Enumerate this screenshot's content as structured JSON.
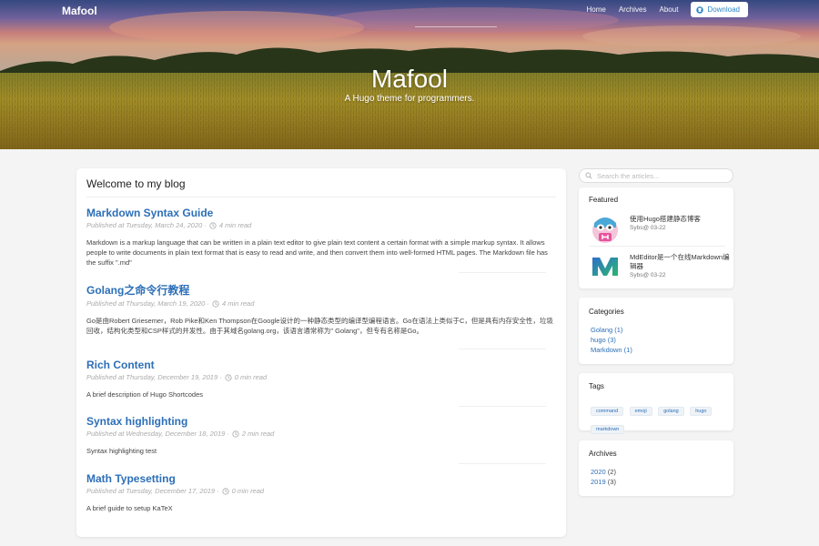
{
  "nav": {
    "brand": "Mafool",
    "links": [
      "Home",
      "Archives",
      "About"
    ],
    "download_label": "Download"
  },
  "hero": {
    "title": "Mafool",
    "subtitle": "A Hugo theme for programmers."
  },
  "main": {
    "heading": "Welcome to my blog",
    "posts": [
      {
        "title": "Markdown Syntax Guide",
        "published": "Published at Tuesday, March 24, 2020 ·",
        "read_time": "4 min read",
        "summary": "Markdown is a markup language that can be written in a plain text editor to give plain text content a certain format with a simple markup syntax. It allows people to write documents in plain text format that is easy to read and write, and then convert them into well-formed HTML pages. The Markdown file has the suffix \".md\""
      },
      {
        "title": "Golang之命令行教程",
        "published": "Published at Thursday, March 19, 2020 ·",
        "read_time": "4 min read",
        "summary": "Go是由Robert Griesemer，Rob Pike和Ken Thompson在Google设计的一种静态类型的编译型编程语言。Go在语法上类似于C，但是具有内存安全性，垃圾回收，结构化类型和CSP样式的并发性。由于其域名golang.org，该语言通常称为\" Golang\"，但专有名称是Go。"
      },
      {
        "title": "Rich Content",
        "published": "Published at Thursday, December 19, 2019 ·",
        "read_time": "0 min read",
        "summary": "A brief description of Hugo Shortcodes"
      },
      {
        "title": "Syntax highlighting",
        "published": "Published at Wednesday, December 18, 2019 ·",
        "read_time": "2 min read",
        "summary": "Syntax highlighting test"
      },
      {
        "title": "Math Typesetting",
        "published": "Published at Tuesday, December 17, 2019 ·",
        "read_time": "0 min read",
        "summary": "A brief guide to setup KaTeX"
      }
    ]
  },
  "sidebar": {
    "search_placeholder": "Search the articles...",
    "featured": {
      "title": "Featured",
      "items": [
        {
          "title": "使用Hugo搭建静态博客",
          "date": "Sybs@ 03-22"
        },
        {
          "title": "MdEditor是一个在线Markdown编辑器",
          "date": "Sybs@ 03-22"
        }
      ]
    },
    "categories": {
      "title": "Categories",
      "items": [
        "Golang (1)",
        "hugo (3)",
        "Markdown (1)"
      ]
    },
    "tags": {
      "title": "Tags",
      "items": [
        "command",
        "emoji",
        "golang",
        "hugo",
        "markdown"
      ]
    },
    "archives": {
      "title": "Archives",
      "items": [
        {
          "year": "2020",
          "count": "(2)"
        },
        {
          "year": "2019",
          "count": "(3)"
        }
      ]
    }
  },
  "colors": {
    "link": "#2d6fb7",
    "download_text": "#2e87c9",
    "background": "#f4f4f4"
  },
  "icons": {
    "download": "github-icon",
    "read_time": "clock-icon",
    "search": "search-icon"
  }
}
